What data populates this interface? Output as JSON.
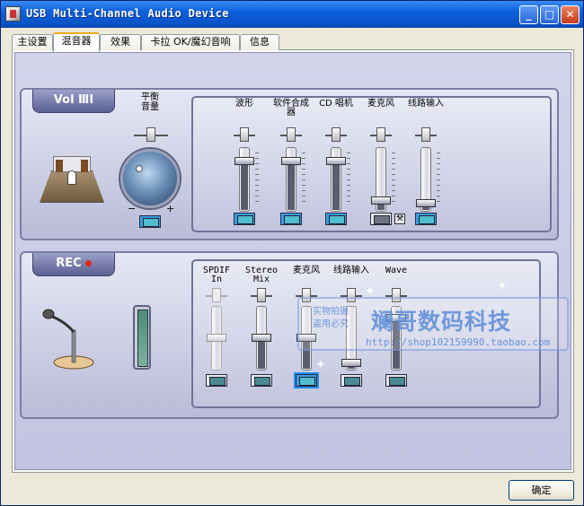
{
  "window": {
    "title": "USB Multi-Channel Audio Device",
    "minimize_glyph": "_",
    "maximize_glyph": "□",
    "close_glyph": "✕"
  },
  "tabs": [
    {
      "label": "主设置",
      "active": false
    },
    {
      "label": "混音器",
      "active": true
    },
    {
      "label": "效果",
      "active": false
    },
    {
      "label": "卡拉 OK/魔幻音响",
      "active": false
    },
    {
      "label": "信息",
      "active": false
    }
  ],
  "playback": {
    "badge": "Vol ⅢⅠ",
    "balance_label": "平衡\n音量",
    "knob_minus": "−",
    "knob_plus": "+",
    "channels": [
      {
        "label": "波形",
        "level": 0.82,
        "muted": false
      },
      {
        "label": "软件合成\n器",
        "level": 0.82,
        "muted": false
      },
      {
        "label": "CD 唱机",
        "level": 0.82,
        "muted": false
      },
      {
        "label": "麦克风",
        "level": 0.12,
        "muted": true
      },
      {
        "label": "线路输入",
        "level": 0.07,
        "muted": false
      }
    ]
  },
  "record": {
    "badge": "REC",
    "channels": [
      {
        "label": "SPDIF\nIn",
        "level": 0.5,
        "disabled": true,
        "selected": false
      },
      {
        "label": "Stereo\nMix",
        "level": 0.5,
        "disabled": false,
        "selected": false
      },
      {
        "label": "麦克风",
        "level": 0.5,
        "disabled": false,
        "selected": true
      },
      {
        "label": "线路输入",
        "level": 0.05,
        "disabled": false,
        "selected": false
      },
      {
        "label": "Wave",
        "level": 0.85,
        "disabled": false,
        "selected": false
      }
    ]
  },
  "watermark": {
    "title": "斓哥数码科技",
    "url": "http://shop102159990.taobao.com",
    "stamp": "实物拍摄\n盗用必究"
  },
  "footer": {
    "ok_label": "确定"
  },
  "colors": {
    "accent_tab": "#f6a820",
    "button_lit": "#3a9ee5",
    "rec_dot": "#e02a10"
  }
}
